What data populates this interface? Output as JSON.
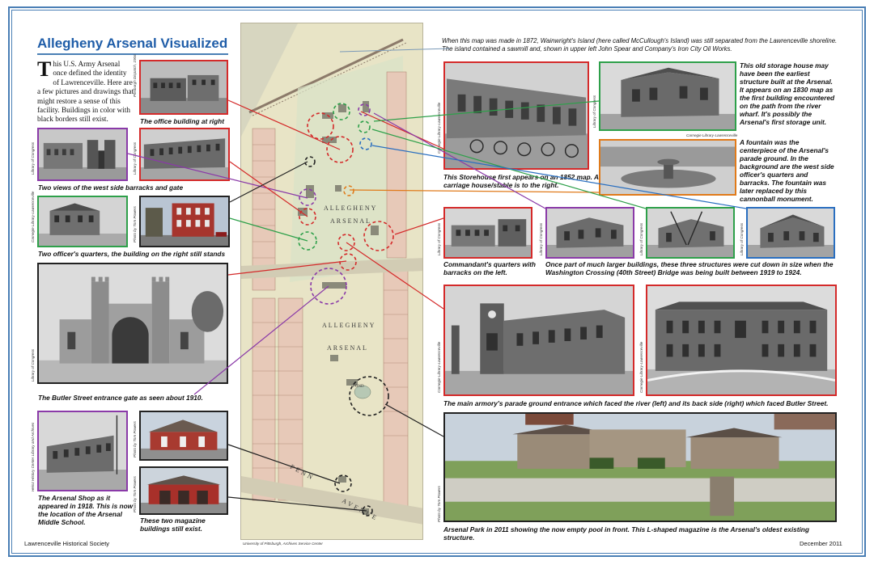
{
  "title": "Allegheny Arsenal Visualized",
  "intro": {
    "dropcap": "T",
    "text": "his U.S. Army Arsenal once defined the identity of Lawrenceville. Here are a few pictures and drawings that might restore a sense of this facility. Buildings in color with black borders still exist."
  },
  "top_note": "When this map was made in 1872, Wainwright's Island (here called McCullough's Island) was still separated from the Lawrenceville shoreline. The island contained a sawmill and, shown in upper left John Spear and Company's Iron City Oil Works.",
  "captions": {
    "office": "The office building at right",
    "barracks": "Two views of the west side barracks and gate",
    "officers": "Two officer's quarters, the building on the right still stands",
    "gate": "The Butler Street entrance gate as seen about 1910.",
    "shop": "The Arsenal Shop as it appeared in 1918. This is now the location of the Arsenal Middle School.",
    "magazine": "These two magazine buildings still exist.",
    "storehouse": "This Storehouse first appears on an 1852 map. A carriage house/stable is to the right.",
    "storage": "This old storage house may have been the earliest structure built at the Arsenal. It appears on an 1830 map as the first building encountered on the path from the river wharf. It's possibly the Arsenal's first storage unit.",
    "fountain": "A fountain was the centerpiece of the Arsenal's parade ground. In the background are the west side officer's quarters and barracks. The fountain was later replaced by this cannonball monument.",
    "commandant": "Commandant's quarters with barracks on the left.",
    "three": "Once part of much larger buildings, these three structures were cut down in size when the Washington Crossing (40th Street) Bridge was being built between 1919 to 1924.",
    "armory": "The main armory's parade ground entrance which faced the river (left) and its back side (right) which faced Butler Street.",
    "park": "Arsenal Park in 2011 showing the now empty pool in front. This L-shaped magazine is the Arsenal's oldest existing structure."
  },
  "credits": {
    "post_gazette": "Pittsburgh Dispatch, 1906",
    "loc": "Library of Congress",
    "tom_powers": "Photo by Tom Powers",
    "cl_lawrenceville": "Carnegie Library-Lawrenceville",
    "heinz": "Heinz History Center Library and Archives",
    "pitt": "University of Pittsburgh, Archives Service Center"
  },
  "map_labels": {
    "allegheny1": "ALLEGHENY",
    "arsenal1": "ARSENAL",
    "allegheny2": "ALLEGHENY",
    "arsenal2": "ARSENAL",
    "penn": "PENN",
    "avenue": "AVENUE",
    "pond": "POND"
  },
  "footer": {
    "left": "Lawrenceville Historical Society",
    "right": "December 2011"
  },
  "colors": {
    "red": "#d42a2a",
    "green": "#2ea04a",
    "purple": "#8a3aa8",
    "blue": "#2a6fc0",
    "orange": "#e07a1a",
    "black": "#222222",
    "title": "#1f5da8"
  }
}
